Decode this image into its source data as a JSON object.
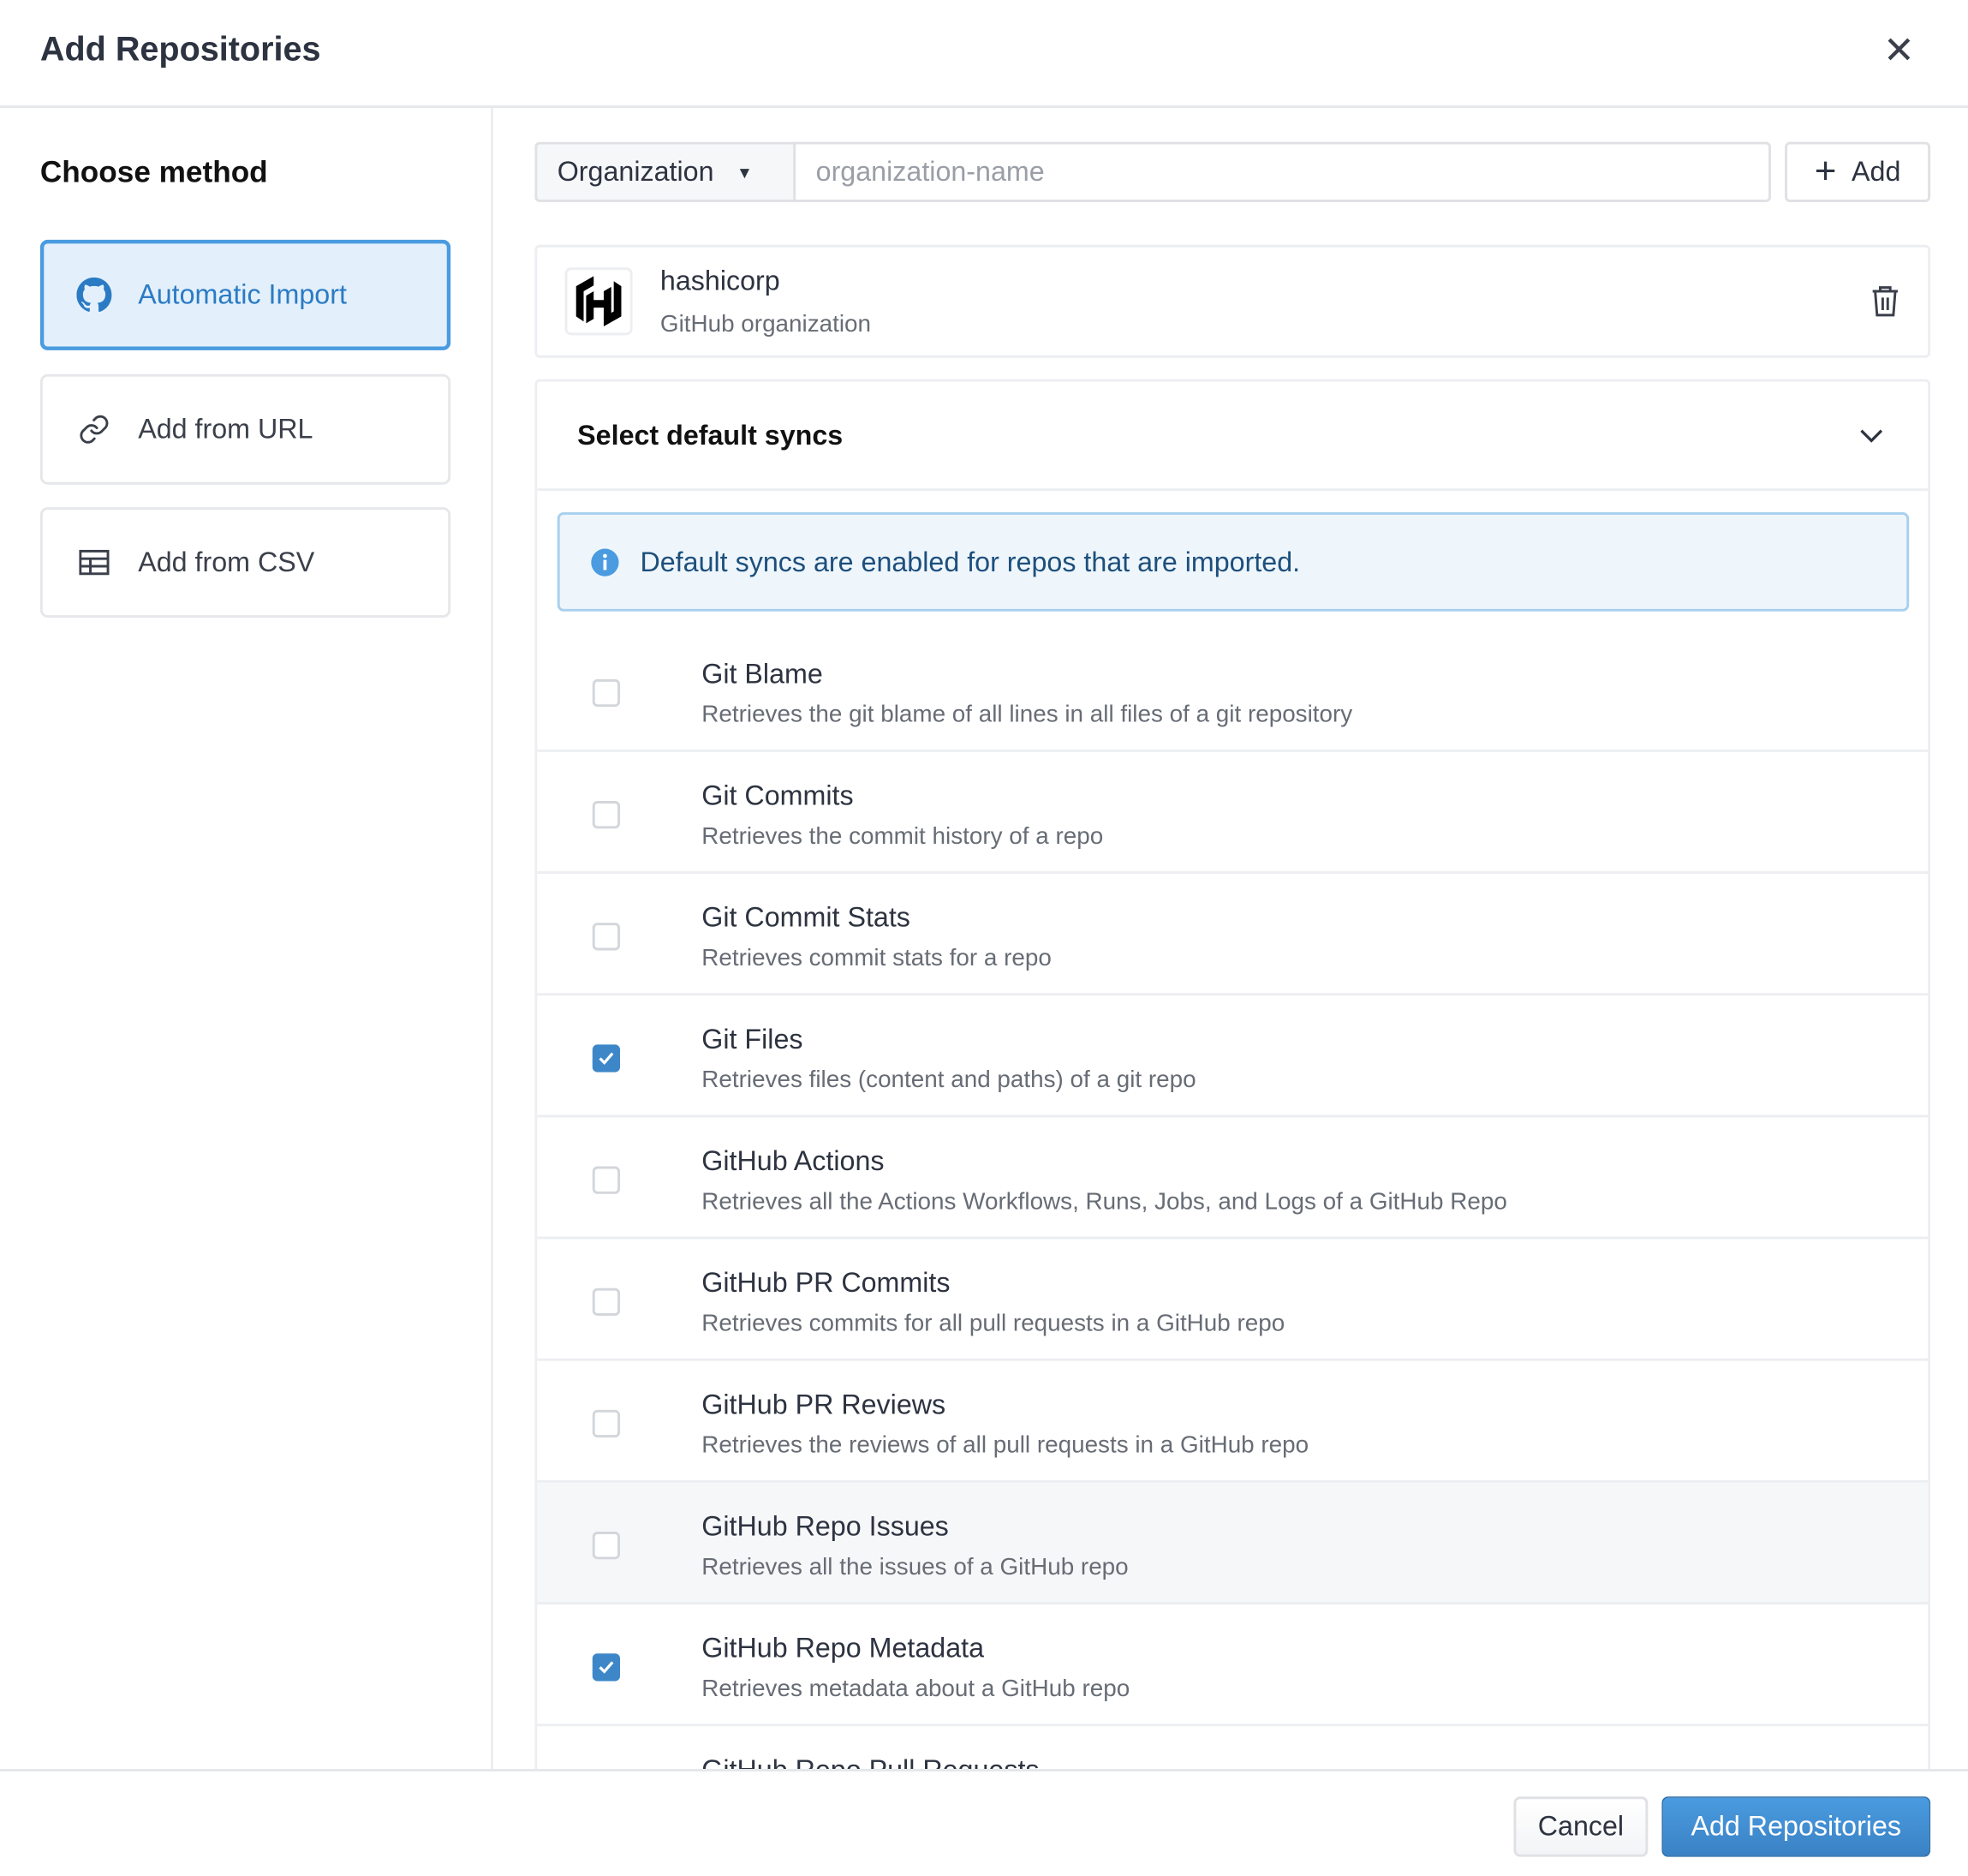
{
  "dialog": {
    "title": "Add Repositories",
    "close_icon": "close-icon"
  },
  "sidebar": {
    "heading": "Choose method",
    "items": [
      {
        "label": "Automatic Import",
        "icon": "github-icon",
        "active": true
      },
      {
        "label": "Add from URL",
        "icon": "link-icon",
        "active": false
      },
      {
        "label": "Add from CSV",
        "icon": "table-icon",
        "active": false
      }
    ]
  },
  "search": {
    "type_selected": "Organization",
    "placeholder": "organization-name",
    "value": "",
    "add_label": "Add"
  },
  "org": {
    "name": "hashicorp",
    "type": "GitHub organization"
  },
  "syncs": {
    "title": "Select default syncs",
    "info": "Default syncs are enabled for repos that are imported.",
    "items": [
      {
        "title": "Git Blame",
        "desc": "Retrieves the git blame of all lines in all files of a git repository",
        "checked": false
      },
      {
        "title": "Git Commits",
        "desc": "Retrieves the commit history of a repo",
        "checked": false
      },
      {
        "title": "Git Commit Stats",
        "desc": "Retrieves commit stats for a repo",
        "checked": false
      },
      {
        "title": "Git Files",
        "desc": "Retrieves files (content and paths) of a git repo",
        "checked": true
      },
      {
        "title": "GitHub Actions",
        "desc": "Retrieves all the Actions Workflows, Runs, Jobs, and Logs of a GitHub Repo",
        "checked": false
      },
      {
        "title": "GitHub PR Commits",
        "desc": "Retrieves commits for all pull requests in a GitHub repo",
        "checked": false
      },
      {
        "title": "GitHub PR Reviews",
        "desc": "Retrieves the reviews of all pull requests in a GitHub repo",
        "checked": false
      },
      {
        "title": "GitHub Repo Issues",
        "desc": "Retrieves all the issues of a GitHub repo",
        "checked": false
      },
      {
        "title": "GitHub Repo Metadata",
        "desc": "Retrieves metadata about a GitHub repo",
        "checked": true
      },
      {
        "title": "GitHub Repo Pull Requests",
        "desc": "",
        "checked": false
      }
    ]
  },
  "footer": {
    "cancel_label": "Cancel",
    "submit_label": "Add Repositories"
  },
  "colors": {
    "accent": "#3d87c9",
    "active_bg": "#e3f0fb",
    "info_bg": "#eef6fc"
  }
}
